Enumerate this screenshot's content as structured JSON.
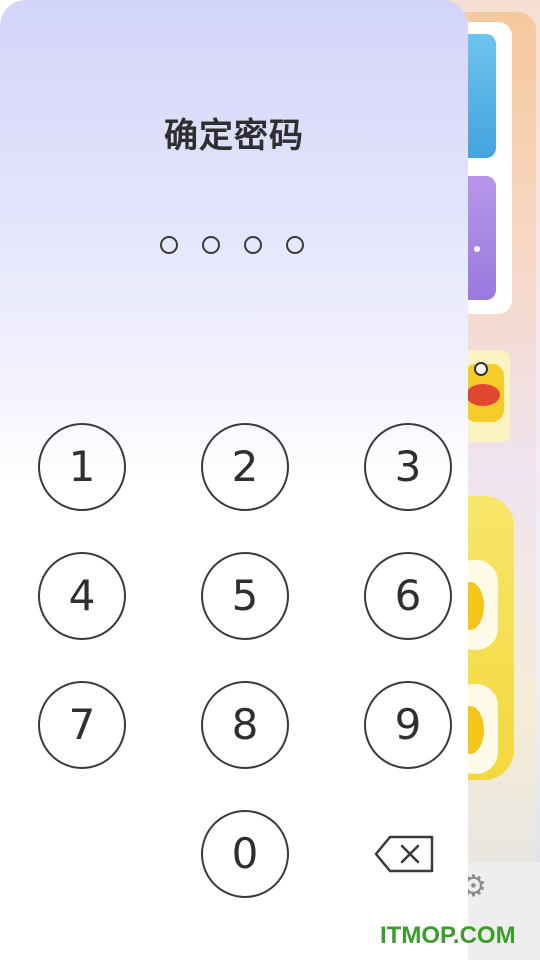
{
  "lock_screen": {
    "title": "确定密码",
    "pin_length": 4,
    "entered_digits": 0,
    "keypad": {
      "keys": [
        "1",
        "2",
        "3",
        "4",
        "5",
        "6",
        "7",
        "8",
        "9",
        "0"
      ],
      "delete_icon": "backspace-icon"
    }
  },
  "background_app": {
    "settings_icon": "gear-icon"
  },
  "watermark": "ITMOP.COM",
  "colors": {
    "panel_gradient_top": "#d3d4fa",
    "panel_bottom": "#ffffff",
    "text": "#2f2f2f",
    "watermark": "#3c9d2c"
  }
}
